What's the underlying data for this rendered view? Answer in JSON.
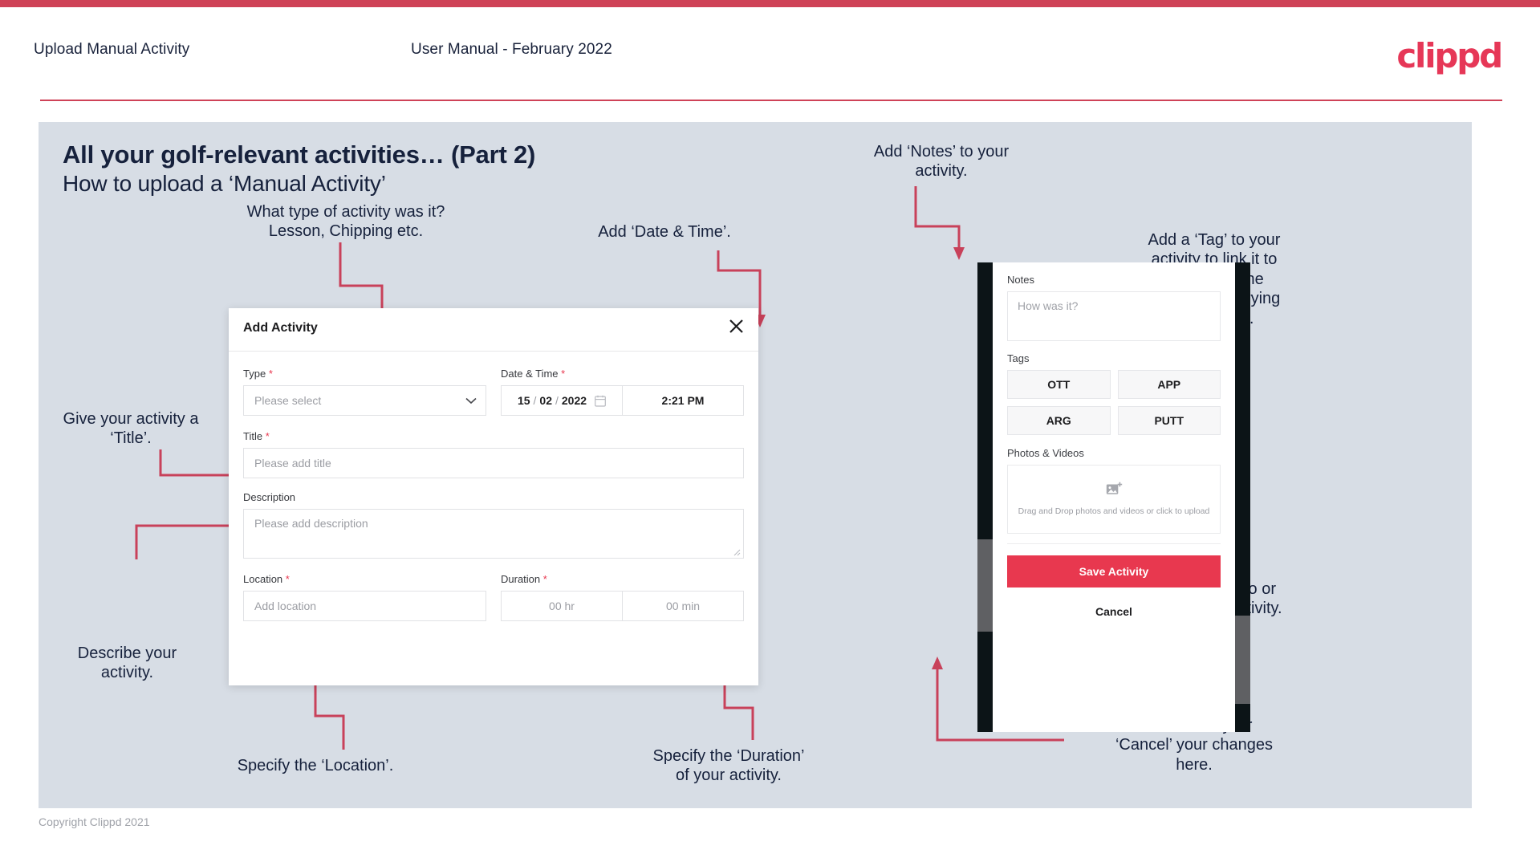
{
  "header": {
    "left_title": "Upload Manual Activity",
    "center_title": "User Manual - February 2022",
    "logo": "clippd"
  },
  "slide": {
    "title_main": "All your golf-relevant activities… (Part 2)",
    "title_sub": "How to upload a ‘Manual Activity’"
  },
  "annotations": {
    "type": "What type of activity was it?\nLesson, Chipping etc.",
    "datetime": "Add ‘Date & Time’.",
    "title": "Give your activity a\n‘Title’.",
    "description": "Describe your\nactivity.",
    "location": "Specify the ‘Location’.",
    "duration": "Specify the ‘Duration’\nof your activity.",
    "notes": "Add ‘Notes’ to your\nactivity.",
    "tags": "Add a ‘Tag’ to your\nactivity to link it to\nthe part of the\ngame you’re trying\nto improve.",
    "upload": "Upload a photo or\nvideo to the activity.",
    "save_cancel": "‘Save Activity’ or\n‘Cancel’ your changes\nhere."
  },
  "modal": {
    "title": "Add Activity",
    "close_icon": "close-icon",
    "fields": {
      "type_label": "Type",
      "type_required": "*",
      "type_placeholder": "Please select",
      "datetime_label": "Date & Time",
      "datetime_required": "*",
      "date_day": "15",
      "date_month": "02",
      "date_year": "2022",
      "date_sep": "/",
      "time_value": "2:21 PM",
      "title_label": "Title",
      "title_required": "*",
      "title_placeholder": "Please add title",
      "description_label": "Description",
      "description_placeholder": "Please add description",
      "location_label": "Location",
      "location_required": "*",
      "location_placeholder": "Add location",
      "duration_label": "Duration",
      "duration_required": "*",
      "duration_hr_placeholder": "00 hr",
      "duration_min_placeholder": "00 min"
    }
  },
  "phone": {
    "notes_label": "Notes",
    "notes_placeholder": "How was it?",
    "tags_label": "Tags",
    "tags": [
      "OTT",
      "APP",
      "ARG",
      "PUTT"
    ],
    "photos_label": "Photos & Videos",
    "dropzone_text": "Drag and Drop photos and videos or click to upload",
    "dropzone_icon": "add-image-icon",
    "save_label": "Save Activity",
    "cancel_label": "Cancel"
  },
  "footer": {
    "copyright": "Copyright Clippd 2021"
  },
  "colors": {
    "brand_red": "#e8384f",
    "bar_red": "#cf4257",
    "arrow_red": "#c8415a",
    "slide_bg": "#d7dde5",
    "ink": "#16213c"
  }
}
